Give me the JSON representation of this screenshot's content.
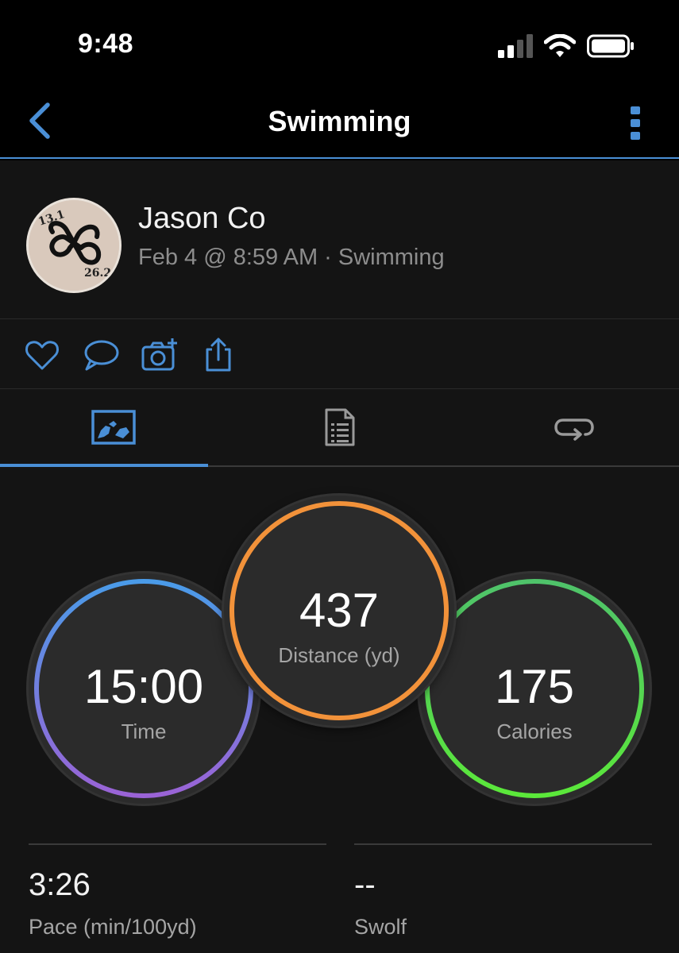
{
  "status_bar": {
    "time": "9:48",
    "icons": [
      "cellular-signal-icon",
      "wifi-icon",
      "battery-icon"
    ]
  },
  "nav": {
    "title": "Swimming",
    "back_icon": "chevron-left-icon",
    "more_icon": "vertical-ellipsis-icon",
    "accent_color": "#4a8fd6"
  },
  "profile": {
    "name": "Jason Co",
    "meta": "Feb 4 @ 8:59 AM · Swimming",
    "avatar_text_top": "13.1",
    "avatar_text_bottom": "26.2"
  },
  "actions": [
    "heart-icon",
    "comment-icon",
    "add-photo-icon",
    "share-icon"
  ],
  "tabs": [
    {
      "icon": "map-chart-icon",
      "active": true
    },
    {
      "icon": "document-list-icon",
      "active": false
    },
    {
      "icon": "laps-repeat-icon",
      "active": false
    }
  ],
  "summary": {
    "time": {
      "value": "15:00",
      "label": "Time",
      "color_top": "#4a9be8",
      "color_bottom": "#9a63d6"
    },
    "distance": {
      "value": "437",
      "label": "Distance (yd)",
      "color": "#f2923a"
    },
    "calories": {
      "value": "175",
      "label": "Calories",
      "color_top": "#4fc36a",
      "color_bottom": "#5be83a"
    }
  },
  "stats": [
    {
      "value": "3:26",
      "label": "Pace (min/100yd)"
    },
    {
      "value": "--",
      "label": "Swolf"
    }
  ]
}
